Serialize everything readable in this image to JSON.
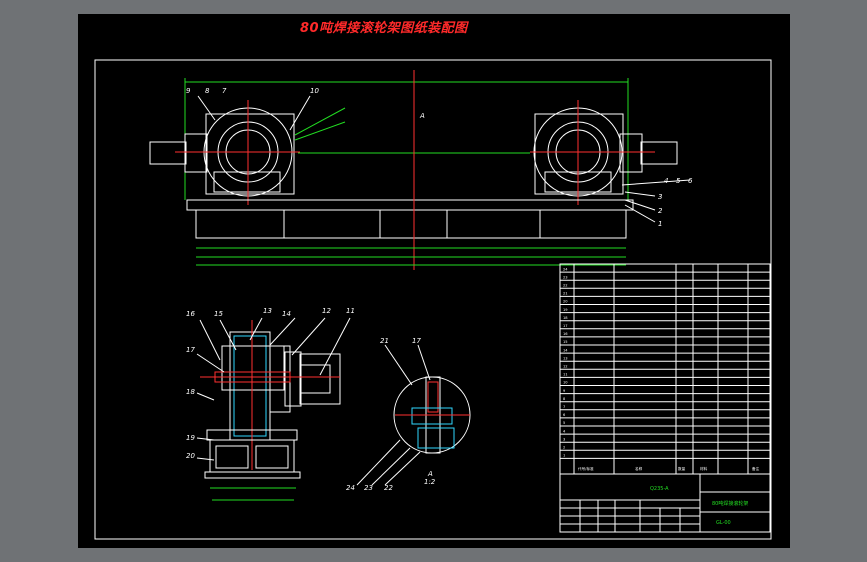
{
  "title": "80吨焊接滚轮架图纸装配图",
  "colors": {
    "background": "#6f7275",
    "sheet": "#000000",
    "title": "#ff2a2a",
    "lines": "#ffffff",
    "dims": "#22dd22",
    "center": "#ff3030",
    "hatch": "#30d8ff"
  },
  "front_view": {
    "part_labels": [
      "9",
      "8",
      "7",
      "10",
      "1",
      "2",
      "3",
      "4",
      "5",
      "6"
    ],
    "section_mark": "A"
  },
  "side_view": {
    "part_labels": [
      "16",
      "15",
      "14",
      "13",
      "12",
      "11",
      "17",
      "18",
      "19",
      "20"
    ]
  },
  "detail_view": {
    "part_labels": [
      "21",
      "17",
      "24",
      "23",
      "22"
    ],
    "detail_mark": "A",
    "detail_scale": "1:2"
  },
  "parts_list": {
    "header": {
      "code": "代号/标准",
      "name": "名称",
      "qty": "数量",
      "material": "材料",
      "note": "备注"
    },
    "row_numbers": [
      "24",
      "23",
      "22",
      "21",
      "20",
      "19",
      "18",
      "17",
      "16",
      "15",
      "14",
      "13",
      "12",
      "11",
      "10",
      "9",
      "8",
      "7",
      "6",
      "5",
      "4",
      "3",
      "2",
      "1"
    ]
  },
  "title_block": {
    "material": "Q235-A",
    "drawing_name": "80吨焊接滚轮架",
    "drawing_number": "GL-00"
  }
}
